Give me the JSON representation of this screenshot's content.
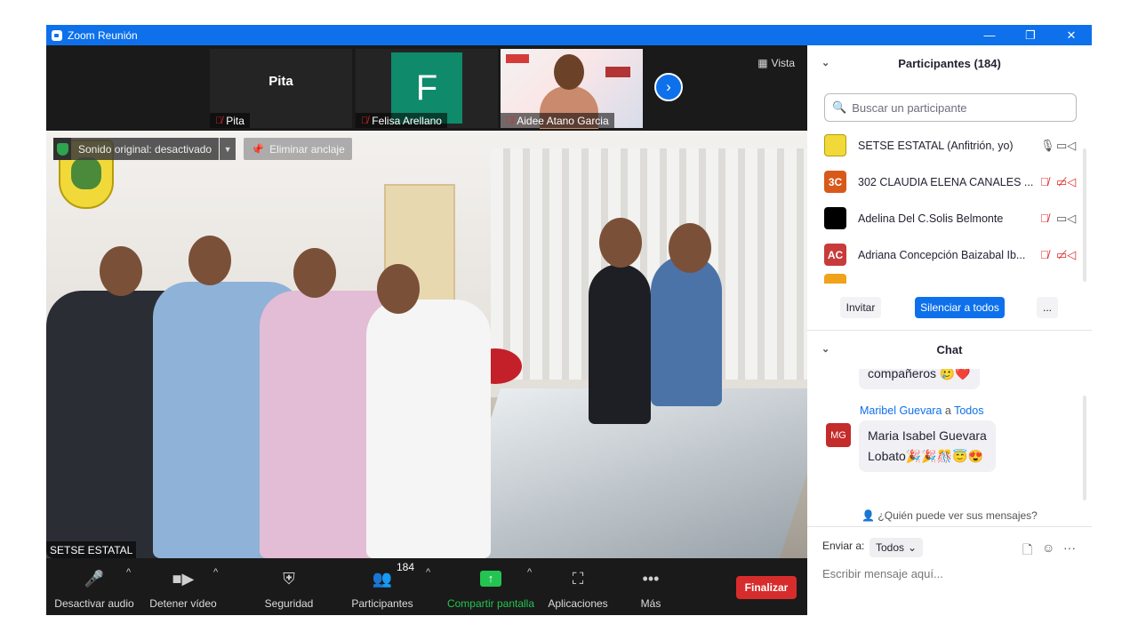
{
  "window": {
    "title": "Zoom Reunión",
    "controls": [
      "—",
      "❐",
      "✕"
    ]
  },
  "strip": {
    "tiles": [
      {
        "label": "Pita",
        "center_text": "Pita"
      },
      {
        "label": "Felisa Arellano",
        "avatar_letter": "F"
      },
      {
        "label": "Aidee Atano Garcia"
      }
    ],
    "next_icon": "›",
    "view_label": "Vista"
  },
  "main": {
    "sound_label": "Sonido original: desactivado",
    "unpin_label": "Eliminar anclaje",
    "speaker": "SETSE ESTATAL"
  },
  "toolbar": {
    "mute": "Desactivar audio",
    "video": "Detener vídeo",
    "security": "Seguridad",
    "participants": "Participantes",
    "participants_count": "184",
    "share": "Compartir pantalla",
    "apps": "Aplicaciones",
    "more": "Más",
    "end": "Finalizar"
  },
  "participants": {
    "header": "Participantes (184)",
    "search_placeholder": "Buscar un participante",
    "list": [
      {
        "name": "SETSE ESTATAL (Anfitrión, yo)",
        "initials": "",
        "color": "#f2d93a",
        "mic_muted": false,
        "video_off": false
      },
      {
        "name": "302 CLAUDIA ELENA CANALES ...",
        "initials": "3C",
        "color": "#d85a1a",
        "mic_muted": true,
        "video_off": true
      },
      {
        "name": "Adelina Del C.Solis Belmonte",
        "initials": "",
        "color": "#000000",
        "mic_muted": true,
        "video_off": false
      },
      {
        "name": "Adriana Concepción Baizabal Ib...",
        "initials": "AC",
        "color": "#c73b3b",
        "mic_muted": true,
        "video_off": true
      }
    ],
    "invite": "Invitar",
    "mute_all": "Silenciar a todos",
    "more": "..."
  },
  "chat": {
    "header": "Chat",
    "prev_message": "compañeros 🥲❤️",
    "message_sender": "Maribel Guevara",
    "message_to": "a",
    "message_recipient": "Todos",
    "message_initials": "MG",
    "message_line1": "Maria Isabel Guevara",
    "message_line2": "Lobato🎉🎉🎊😇😍",
    "who_can_see": "¿Quién puede ver sus mensajes?",
    "send_to_label": "Enviar a:",
    "send_to_value": "Todos",
    "compose_placeholder": "Escribir mensaje aquí..."
  }
}
